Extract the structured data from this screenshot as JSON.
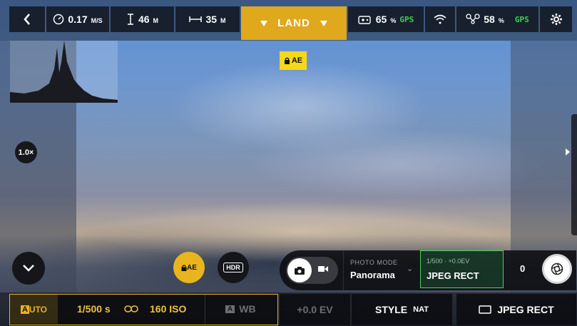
{
  "topbar": {
    "speed_value": "0.17",
    "speed_unit": "M/S",
    "altitude_value": "46",
    "altitude_unit": "M",
    "distance_value": "35",
    "distance_unit": "M",
    "land_label": "LAND",
    "controller_battery": "65",
    "controller_battery_unit": "%",
    "controller_gps": "GPS",
    "drone_battery": "58",
    "drone_battery_unit": "%",
    "drone_gps": "GPS"
  },
  "ae_badge_label": "AE",
  "zoom_label": "1.0×",
  "controls": {
    "ae_lock_label": "AE",
    "hdr_label": "HDR",
    "photo_mode_label": "PHOTO MODE",
    "photo_mode_value": "Panorama",
    "settings_top": "1/500 · +0.0EV",
    "settings_format": "JPEG RECT",
    "counter": "0"
  },
  "bottombar": {
    "auto_letter": "A",
    "auto_rest": "UTO",
    "shutter_speed": "1/500 s",
    "iso": "160 ISO",
    "wb_letter": "A",
    "wb_label": "WB",
    "ev": "+0.0 EV",
    "style_label": "STYLE",
    "style_value": "NAT",
    "format": "JPEG RECT"
  },
  "colors": {
    "accent": "#e0a81c",
    "gps_green": "#3cd54a",
    "ae_yellow": "#f5d817",
    "selected_green": "#49d25a"
  }
}
